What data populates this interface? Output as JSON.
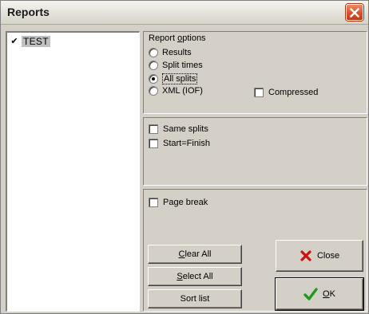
{
  "window": {
    "title": "Reports",
    "close_icon": "close-x-icon",
    "close_color": "#d9512a"
  },
  "list": {
    "items": [
      {
        "label": "TEST",
        "checked": true,
        "check_glyph": "✔"
      }
    ]
  },
  "report_options": {
    "label_prefix": "Report ",
    "label_access": "o",
    "label_rest": "ptions",
    "radios": [
      {
        "label": "Results",
        "checked": false
      },
      {
        "label": "Split times",
        "checked": false
      },
      {
        "label": "All splits",
        "checked": true
      },
      {
        "label": "XML (IOF)",
        "checked": false
      }
    ],
    "compressed": {
      "label": "Compressed",
      "checked": false
    }
  },
  "filters": {
    "checkboxes": [
      {
        "label": "Same splits",
        "checked": false
      },
      {
        "label": "Start=Finish",
        "checked": false
      }
    ]
  },
  "page_break": {
    "label": "Page break",
    "checked": false
  },
  "buttons": {
    "clear_all": {
      "access": "C",
      "rest": "lear All"
    },
    "select_all": {
      "access": "S",
      "rest": "elect All"
    },
    "sort_list": {
      "label": "Sort list"
    },
    "close": {
      "label": "Close",
      "icon": "red-x-icon",
      "icon_color": "#cc1111"
    },
    "ok": {
      "access": "O",
      "rest": "K",
      "icon": "green-check-icon",
      "icon_color": "#1f9a1f"
    }
  }
}
